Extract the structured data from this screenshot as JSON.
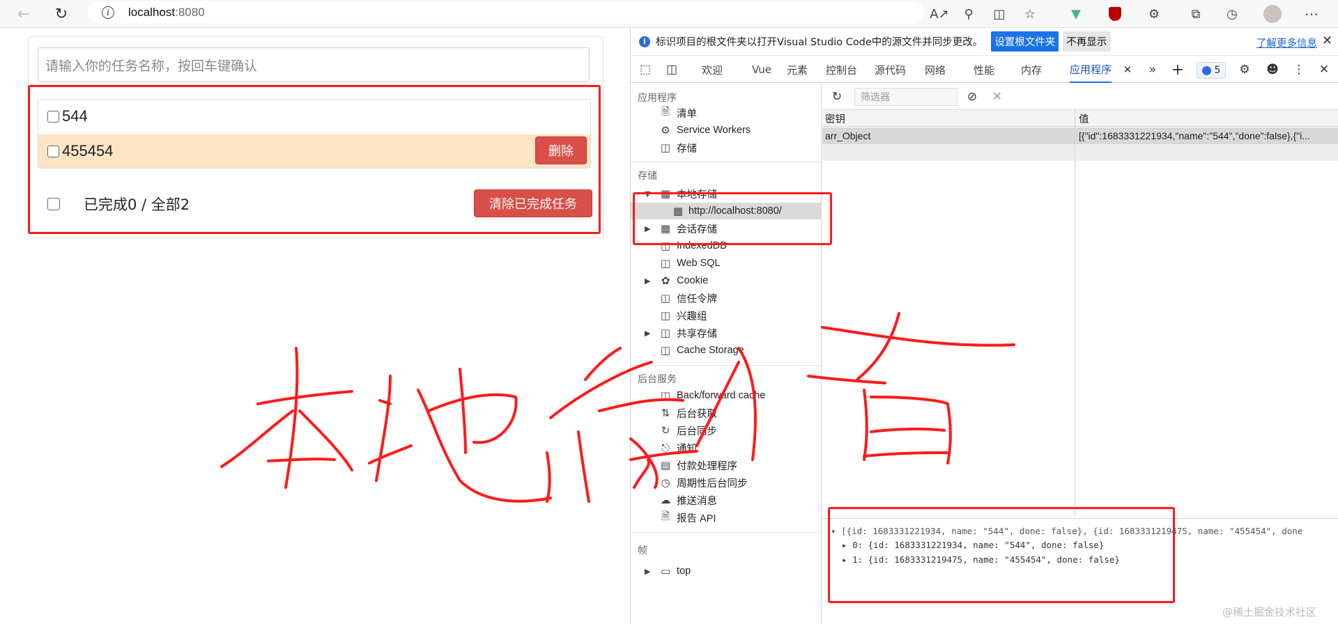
{
  "browser": {
    "url_host": "localhost",
    "url_port": ":8080"
  },
  "app": {
    "input_placeholder": "请输入你的任务名称，按回车键确认",
    "tasks": [
      {
        "name": "544",
        "done": false
      },
      {
        "name": "455454",
        "done": false
      }
    ],
    "delete_label": "删除",
    "summary": "已完成0 / 全部2",
    "clear_done_label": "清除已完成任务"
  },
  "devtools": {
    "infobar": {
      "message": "标识项目的根文件夹以打开Visual Studio Code中的源文件并同步更改。",
      "set_root_label": "设置根文件夹",
      "dont_show_label": "不再显示",
      "learn_more_label": "了解更多信息"
    },
    "tabs": [
      "欢迎",
      "Vue",
      "元素",
      "控制台",
      "源代码",
      "网络",
      "性能",
      "内存",
      "应用程序"
    ],
    "active_tab": "应用程序",
    "issues_count": "5",
    "sidebar": {
      "section_app": "应用程序",
      "app_items": [
        "清单",
        "Service Workers",
        "存储"
      ],
      "section_storage": "存储",
      "local_storage": "本地存储",
      "local_storage_child": "http://localhost:8080/",
      "storage_items": [
        "会话存储",
        "IndexedDB",
        "Web SQL",
        "Cookie",
        "信任令牌",
        "兴趣组",
        "共享存储",
        "Cache Storage"
      ],
      "section_background": "后台服务",
      "background_items": [
        "Back/forward cache",
        "后台获取",
        "后台同步",
        "通知",
        "付款处理程序",
        "周期性后台同步",
        "推送消息",
        "报告 API"
      ],
      "section_frames": "帧",
      "frames_items": [
        "top"
      ]
    },
    "filter_placeholder": "筛选器",
    "table": {
      "col_key": "密钥",
      "col_value": "值",
      "rows": [
        {
          "key": "arr_Object",
          "value": "[{\"id\":1683331221934,\"name\":\"544\",\"done\":false},{\"i..."
        }
      ]
    },
    "preview": {
      "summary": "[{id: 1683331221934, name: \"544\", done: false}, {id: 1683331219475, name: \"455454\", done",
      "item0": "0: {id: 1683331221934, name: \"544\", done: false}",
      "item1": "1: {id: 1683331219475, name: \"455454\", done: false}"
    }
  },
  "handwriting": "本地存储",
  "watermark": "@稀土掘金技术社区",
  "colors": {
    "annotation_red": "#ff1a1a",
    "danger_button": "#da4f49",
    "hover_row": "#fde4c4",
    "devtools_accent": "#1a73e8"
  }
}
